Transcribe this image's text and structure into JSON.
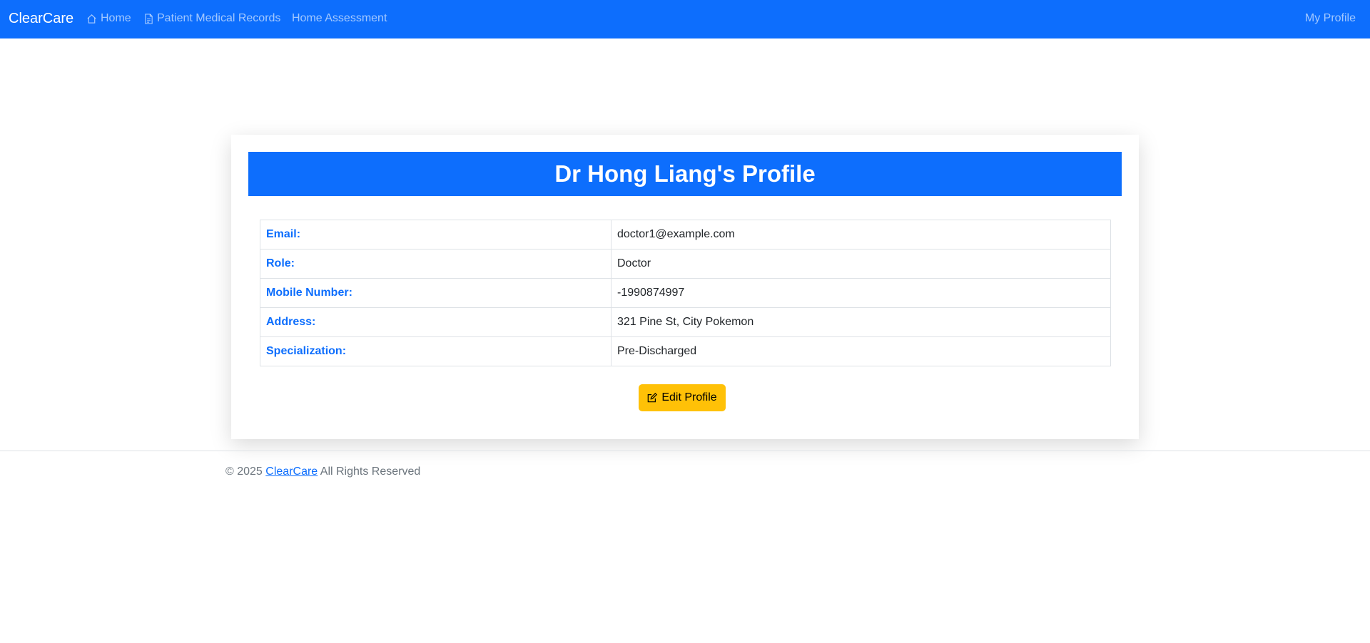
{
  "navbar": {
    "brand": "ClearCare",
    "links": [
      {
        "label": "Home",
        "icon": "house-icon"
      },
      {
        "label": "Patient Medical Records",
        "icon": "file-icon"
      },
      {
        "label": "Home Assessment"
      }
    ],
    "profile_label": "My Profile",
    "color": "#0d6efd"
  },
  "profile": {
    "title": "Dr Hong Liang's Profile",
    "rows": [
      {
        "label": "Email:",
        "value": "doctor1@example.com"
      },
      {
        "label": "Role:",
        "value": "Doctor"
      },
      {
        "label": "Mobile Number:",
        "value": "-1990874997"
      },
      {
        "label": "Address:",
        "value": "321 Pine St, City Pokemon"
      },
      {
        "label": "Specialization:",
        "value": "Pre-Discharged"
      }
    ],
    "edit_button": {
      "label": "Edit Profile",
      "icon": "pencil-square-icon",
      "color": "#ffc107"
    }
  },
  "footer": {
    "prefix": "© 2025",
    "link": "ClearCare",
    "suffix": "All Rights Reserved"
  }
}
